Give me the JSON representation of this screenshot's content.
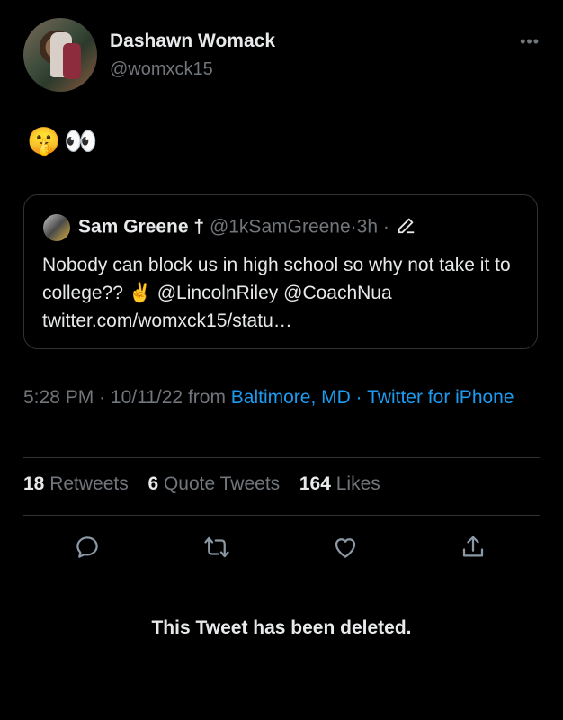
{
  "author": {
    "name": "Dashawn Womack",
    "handle": "@womxck15",
    "more_label": "•••"
  },
  "tweet": {
    "text": "🤫👀"
  },
  "quote": {
    "name": "Sam Greene †",
    "handle": "@1kSamGreene",
    "sep1": "·",
    "time": "3h",
    "sep2": "·",
    "text_main": "Nobody can block us in high school so why not take it to college?? ✌️",
    "mention1": "@LincolnRiley",
    "mention2": "@CoachNua",
    "link": "twitter.com/womxck15/statu…"
  },
  "meta": {
    "time": "5:28 PM",
    "dot1": "·",
    "date": "10/11/22",
    "from": "from",
    "location": "Baltimore, MD",
    "dot2": "·",
    "source": "Twitter for iPhone"
  },
  "stats": {
    "retweets_count": "18",
    "retweets_label": "Retweets",
    "quotes_count": "6",
    "quotes_label": "Quote Tweets",
    "likes_count": "164",
    "likes_label": "Likes"
  },
  "actions": [
    "reply-icon",
    "retweet-icon",
    "like-icon",
    "share-icon"
  ],
  "deleted_notice": "This Tweet has been deleted.",
  "colors": {
    "background": "#000000",
    "text": "#e7e9ea",
    "muted": "#71767b",
    "link": "#1d9bf0",
    "border": "#2f3336"
  }
}
